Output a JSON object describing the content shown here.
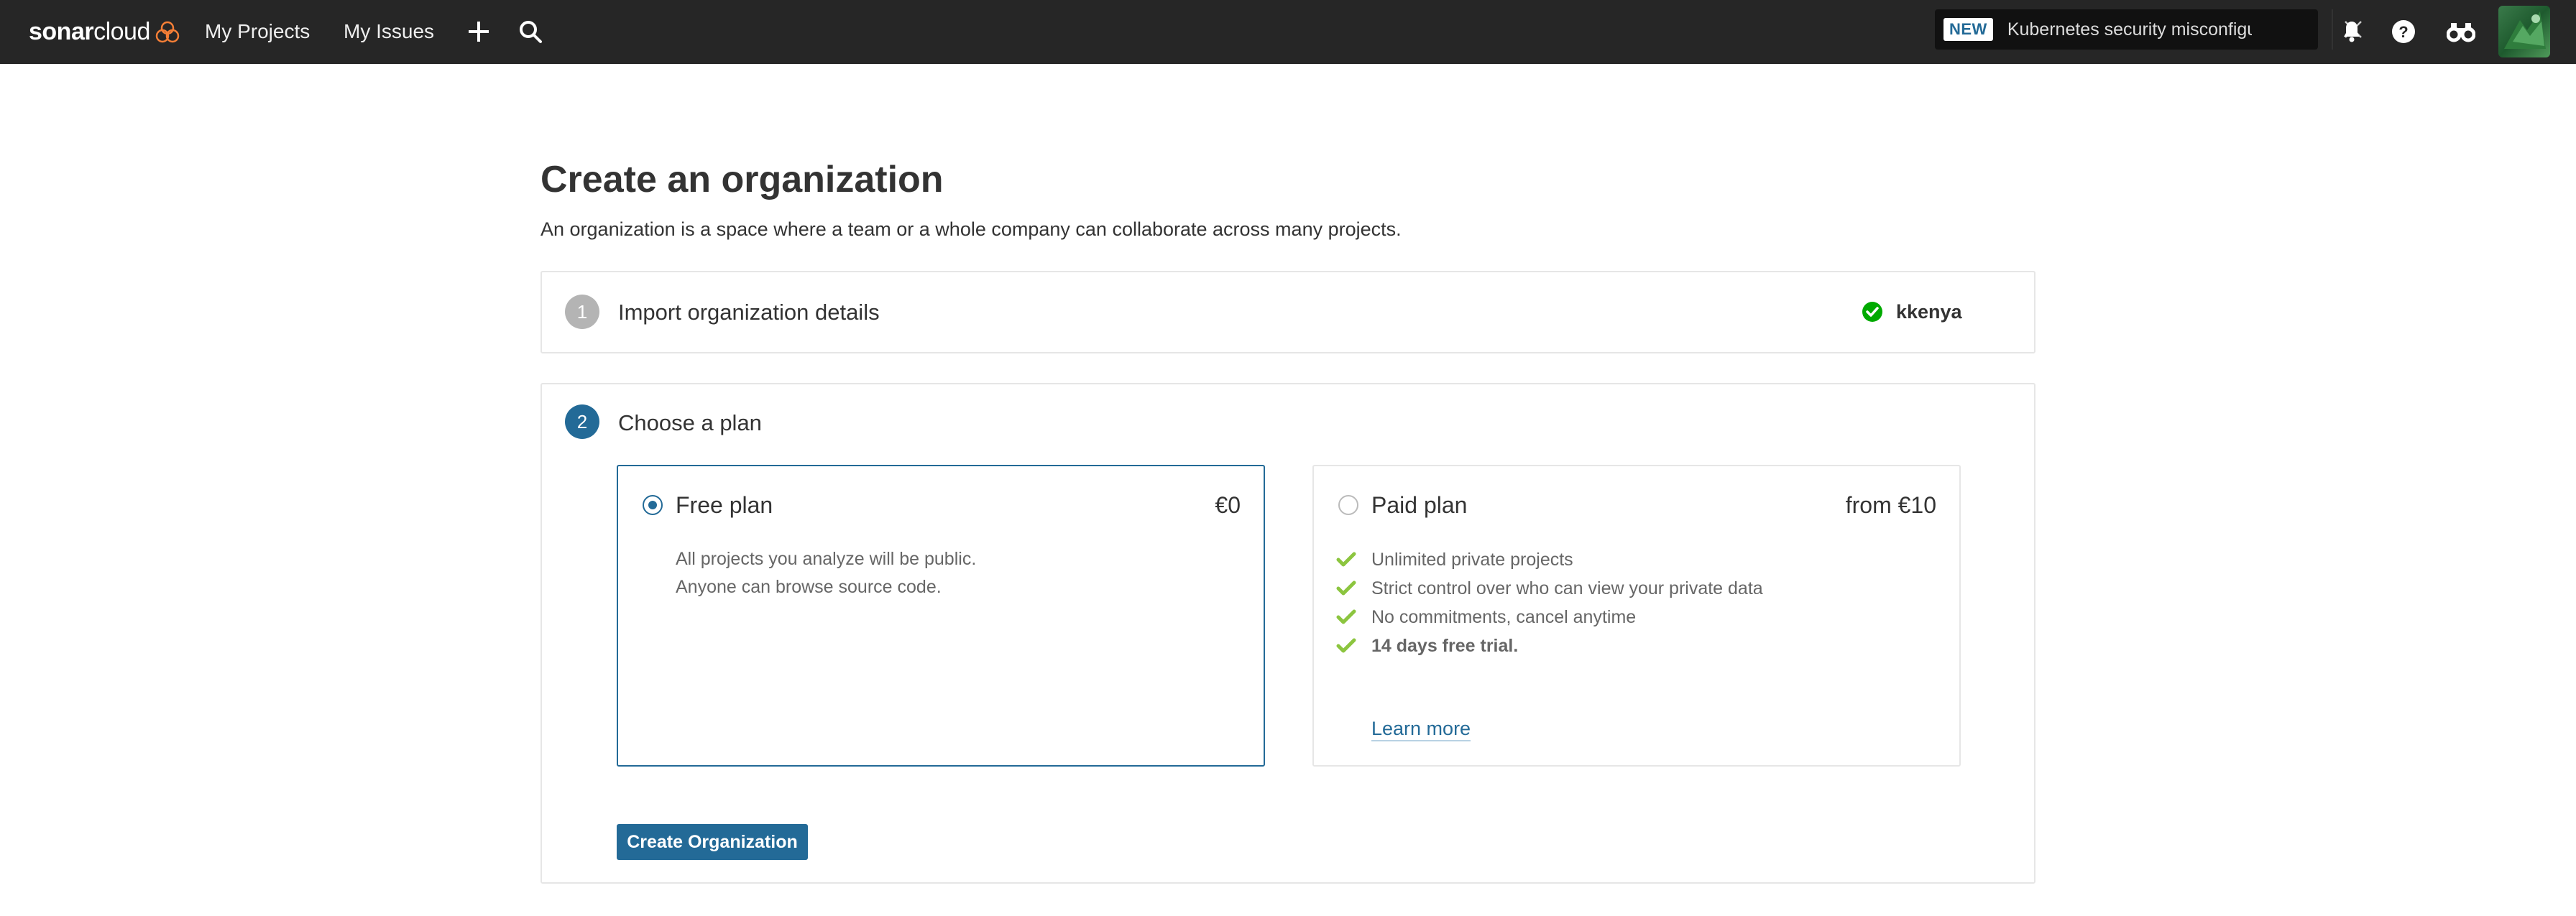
{
  "navbar": {
    "logo_brand": "sonar",
    "logo_suffix": "cloud",
    "links": [
      "My Projects",
      "My Issues"
    ],
    "news_badge": "NEW",
    "news_text": "Kubernetes security misconfigu...",
    "icons": [
      "plus-icon",
      "search-icon",
      "close-icon",
      "bell-icon",
      "help-icon",
      "binoculars-icon"
    ]
  },
  "page": {
    "title": "Create an organization",
    "description": "An organization is a space where a team or a whole company can collaborate across many projects."
  },
  "step1": {
    "number": "1",
    "title": "Import organization details",
    "org_name": "kkenya",
    "status": "complete"
  },
  "step2": {
    "number": "2",
    "title": "Choose a plan",
    "free_plan": {
      "name": "Free plan",
      "price": "€0",
      "selected": true,
      "desc_line1": "All projects you analyze will be public.",
      "desc_line2": "Anyone can browse source code."
    },
    "paid_plan": {
      "name": "Paid plan",
      "price": "from €10",
      "selected": false,
      "features": [
        "Unlimited private projects",
        "Strict control over who can view your private data",
        "No commitments, cancel anytime",
        "14 days free trial."
      ],
      "learn_more": "Learn more"
    },
    "create_button": "Create Organization"
  },
  "colors": {
    "navbar_bg": "#262626",
    "accent_blue": "#236a97",
    "check_green": "#8cc53f",
    "success_green": "#00aa00",
    "logo_orange": "#f47e36"
  }
}
